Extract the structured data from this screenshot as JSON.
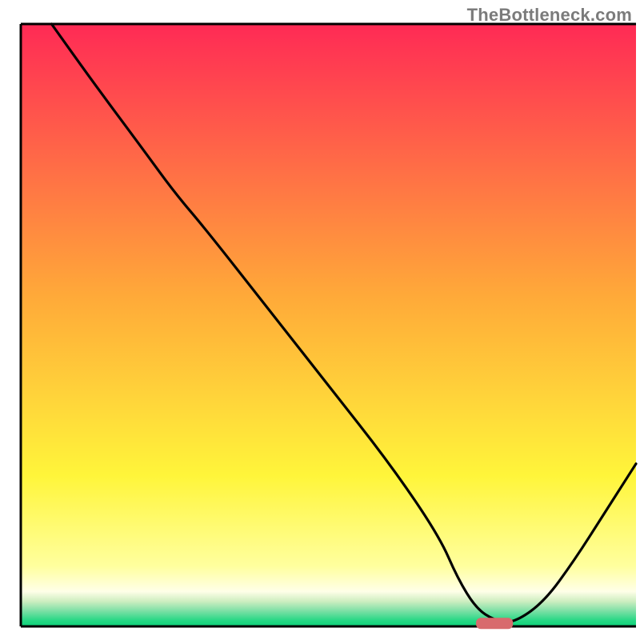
{
  "attribution": "TheBottleneck.com",
  "colors": {
    "frame": "#000000",
    "curve": "#000000",
    "marker_fill": "#d86a6d",
    "gradient_stops": [
      {
        "offset": 0.0,
        "color": "#ff2a55"
      },
      {
        "offset": 0.45,
        "color": "#ffa939"
      },
      {
        "offset": 0.75,
        "color": "#fff53a"
      },
      {
        "offset": 0.9,
        "color": "#ffff9e"
      },
      {
        "offset": 0.942,
        "color": "#ffffe8"
      },
      {
        "offset": 0.958,
        "color": "#cfeec1"
      },
      {
        "offset": 0.974,
        "color": "#7ee0a6"
      },
      {
        "offset": 0.99,
        "color": "#27d885"
      },
      {
        "offset": 1.0,
        "color": "#0bd177"
      }
    ]
  },
  "chart_data": {
    "type": "line",
    "title": "",
    "xlabel": "",
    "ylabel": "",
    "xlim": [
      0,
      100
    ],
    "ylim": [
      0,
      100
    ],
    "grid": false,
    "legend": false,
    "series": [
      {
        "name": "bottleneck-curve",
        "x": [
          5,
          12,
          20,
          25,
          30,
          40,
          50,
          60,
          68,
          71,
          74,
          77,
          80,
          85,
          90,
          95,
          100
        ],
        "y": [
          100,
          90,
          79,
          72,
          66,
          53,
          40,
          27,
          15,
          8,
          3,
          1,
          0.5,
          4,
          11,
          19,
          27
        ]
      }
    ],
    "marker": {
      "name": "optimum-marker",
      "x_start": 74,
      "x_end": 80,
      "y": 0.5,
      "shape": "rounded-bar"
    },
    "notes": "Axes are unlabeled in the image; x and y expressed as 0–100 % of the plot area. Curve values estimated from pixel positions."
  }
}
